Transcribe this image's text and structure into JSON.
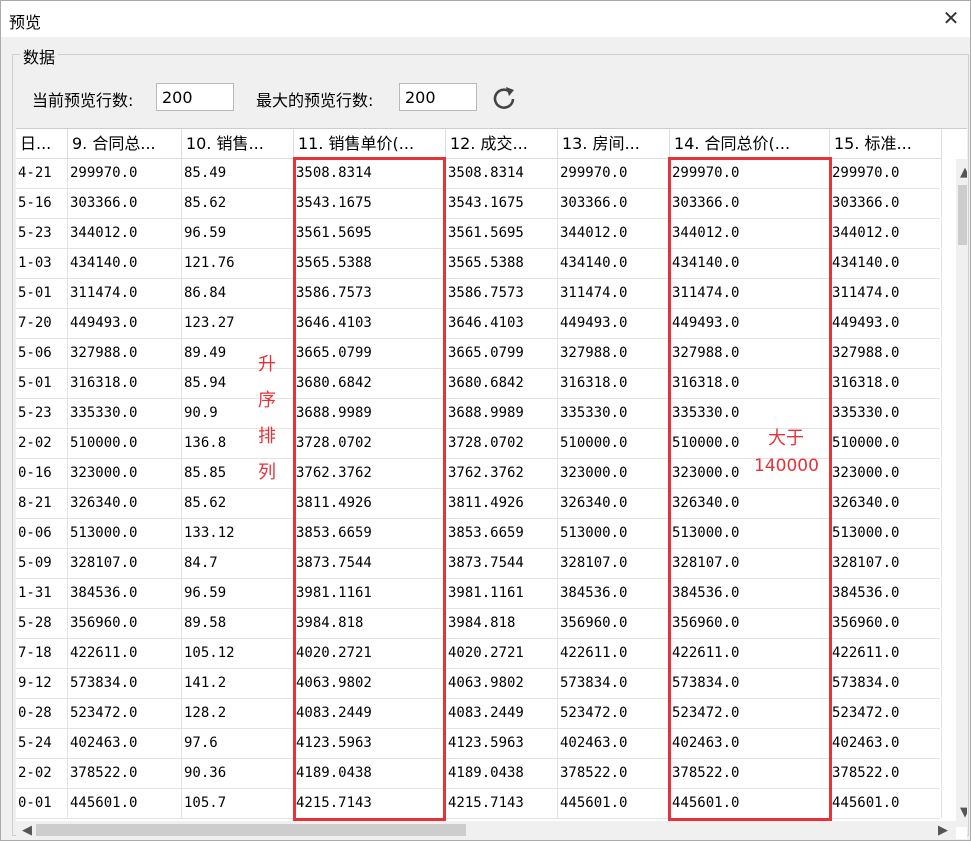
{
  "window": {
    "title": "预览",
    "close_glyph": "✕"
  },
  "group_label": "数据",
  "controls": {
    "current_rows_label": "当前预览行数:",
    "current_rows_value": "200",
    "max_rows_label": "最大的预览行数:",
    "max_rows_value": "200",
    "refresh_icon": "refresh-icon"
  },
  "columns": [
    "日...",
    "9. 合同总...",
    "10. 销售...",
    "11. 销售单价(...",
    "12. 成交...",
    "13. 房间...",
    "14. 合同总价(...",
    "15. 标准..."
  ],
  "rows": [
    [
      "4-21",
      "299970.0",
      "85.49",
      "3508.8314",
      "3508.8314",
      "299970.0",
      "299970.0",
      "299970.0"
    ],
    [
      "5-16",
      "303366.0",
      "85.62",
      "3543.1675",
      "3543.1675",
      "303366.0",
      "303366.0",
      "303366.0"
    ],
    [
      "5-23",
      "344012.0",
      "96.59",
      "3561.5695",
      "3561.5695",
      "344012.0",
      "344012.0",
      "344012.0"
    ],
    [
      "1-03",
      "434140.0",
      "121.76",
      "3565.5388",
      "3565.5388",
      "434140.0",
      "434140.0",
      "434140.0"
    ],
    [
      "5-01",
      "311474.0",
      "86.84",
      "3586.7573",
      "3586.7573",
      "311474.0",
      "311474.0",
      "311474.0"
    ],
    [
      "7-20",
      "449493.0",
      "123.27",
      "3646.4103",
      "3646.4103",
      "449493.0",
      "449493.0",
      "449493.0"
    ],
    [
      "5-06",
      "327988.0",
      "89.49",
      "3665.0799",
      "3665.0799",
      "327988.0",
      "327988.0",
      "327988.0"
    ],
    [
      "5-01",
      "316318.0",
      "85.94",
      "3680.6842",
      "3680.6842",
      "316318.0",
      "316318.0",
      "316318.0"
    ],
    [
      "5-23",
      "335330.0",
      "90.9",
      "3688.9989",
      "3688.9989",
      "335330.0",
      "335330.0",
      "335330.0"
    ],
    [
      "2-02",
      "510000.0",
      "136.8",
      "3728.0702",
      "3728.0702",
      "510000.0",
      "510000.0",
      "510000.0"
    ],
    [
      "0-16",
      "323000.0",
      "85.85",
      "3762.3762",
      "3762.3762",
      "323000.0",
      "323000.0",
      "323000.0"
    ],
    [
      "8-21",
      "326340.0",
      "85.62",
      "3811.4926",
      "3811.4926",
      "326340.0",
      "326340.0",
      "326340.0"
    ],
    [
      "0-06",
      "513000.0",
      "133.12",
      "3853.6659",
      "3853.6659",
      "513000.0",
      "513000.0",
      "513000.0"
    ],
    [
      "5-09",
      "328107.0",
      "84.7",
      "3873.7544",
      "3873.7544",
      "328107.0",
      "328107.0",
      "328107.0"
    ],
    [
      "1-31",
      "384536.0",
      "96.59",
      "3981.1161",
      "3981.1161",
      "384536.0",
      "384536.0",
      "384536.0"
    ],
    [
      "5-28",
      "356960.0",
      "89.58",
      "3984.818",
      "3984.818",
      "356960.0",
      "356960.0",
      "356960.0"
    ],
    [
      "7-18",
      "422611.0",
      "105.12",
      "4020.2721",
      "4020.2721",
      "422611.0",
      "422611.0",
      "422611.0"
    ],
    [
      "9-12",
      "573834.0",
      "141.2",
      "4063.9802",
      "4063.9802",
      "573834.0",
      "573834.0",
      "573834.0"
    ],
    [
      "0-28",
      "523472.0",
      "128.2",
      "4083.2449",
      "4083.2449",
      "523472.0",
      "523472.0",
      "523472.0"
    ],
    [
      "5-24",
      "402463.0",
      "97.6",
      "4123.5963",
      "4123.5963",
      "402463.0",
      "402463.0",
      "402463.0"
    ],
    [
      "2-02",
      "378522.0",
      "90.36",
      "4189.0438",
      "4189.0438",
      "378522.0",
      "378522.0",
      "378522.0"
    ],
    [
      "0-01",
      "445601.0",
      "105.7",
      "4215.7143",
      "4215.7143",
      "445601.0",
      "445601.0",
      "445601.0"
    ]
  ],
  "annotations": {
    "sort_note": [
      "升",
      "序",
      "排",
      "列"
    ],
    "filter_note_line1": "大于",
    "filter_note_line2": "140000",
    "color": "#e8323a"
  },
  "scrollbars": {
    "up": "▲",
    "down": "▼",
    "left": "◀",
    "right": "▶"
  }
}
